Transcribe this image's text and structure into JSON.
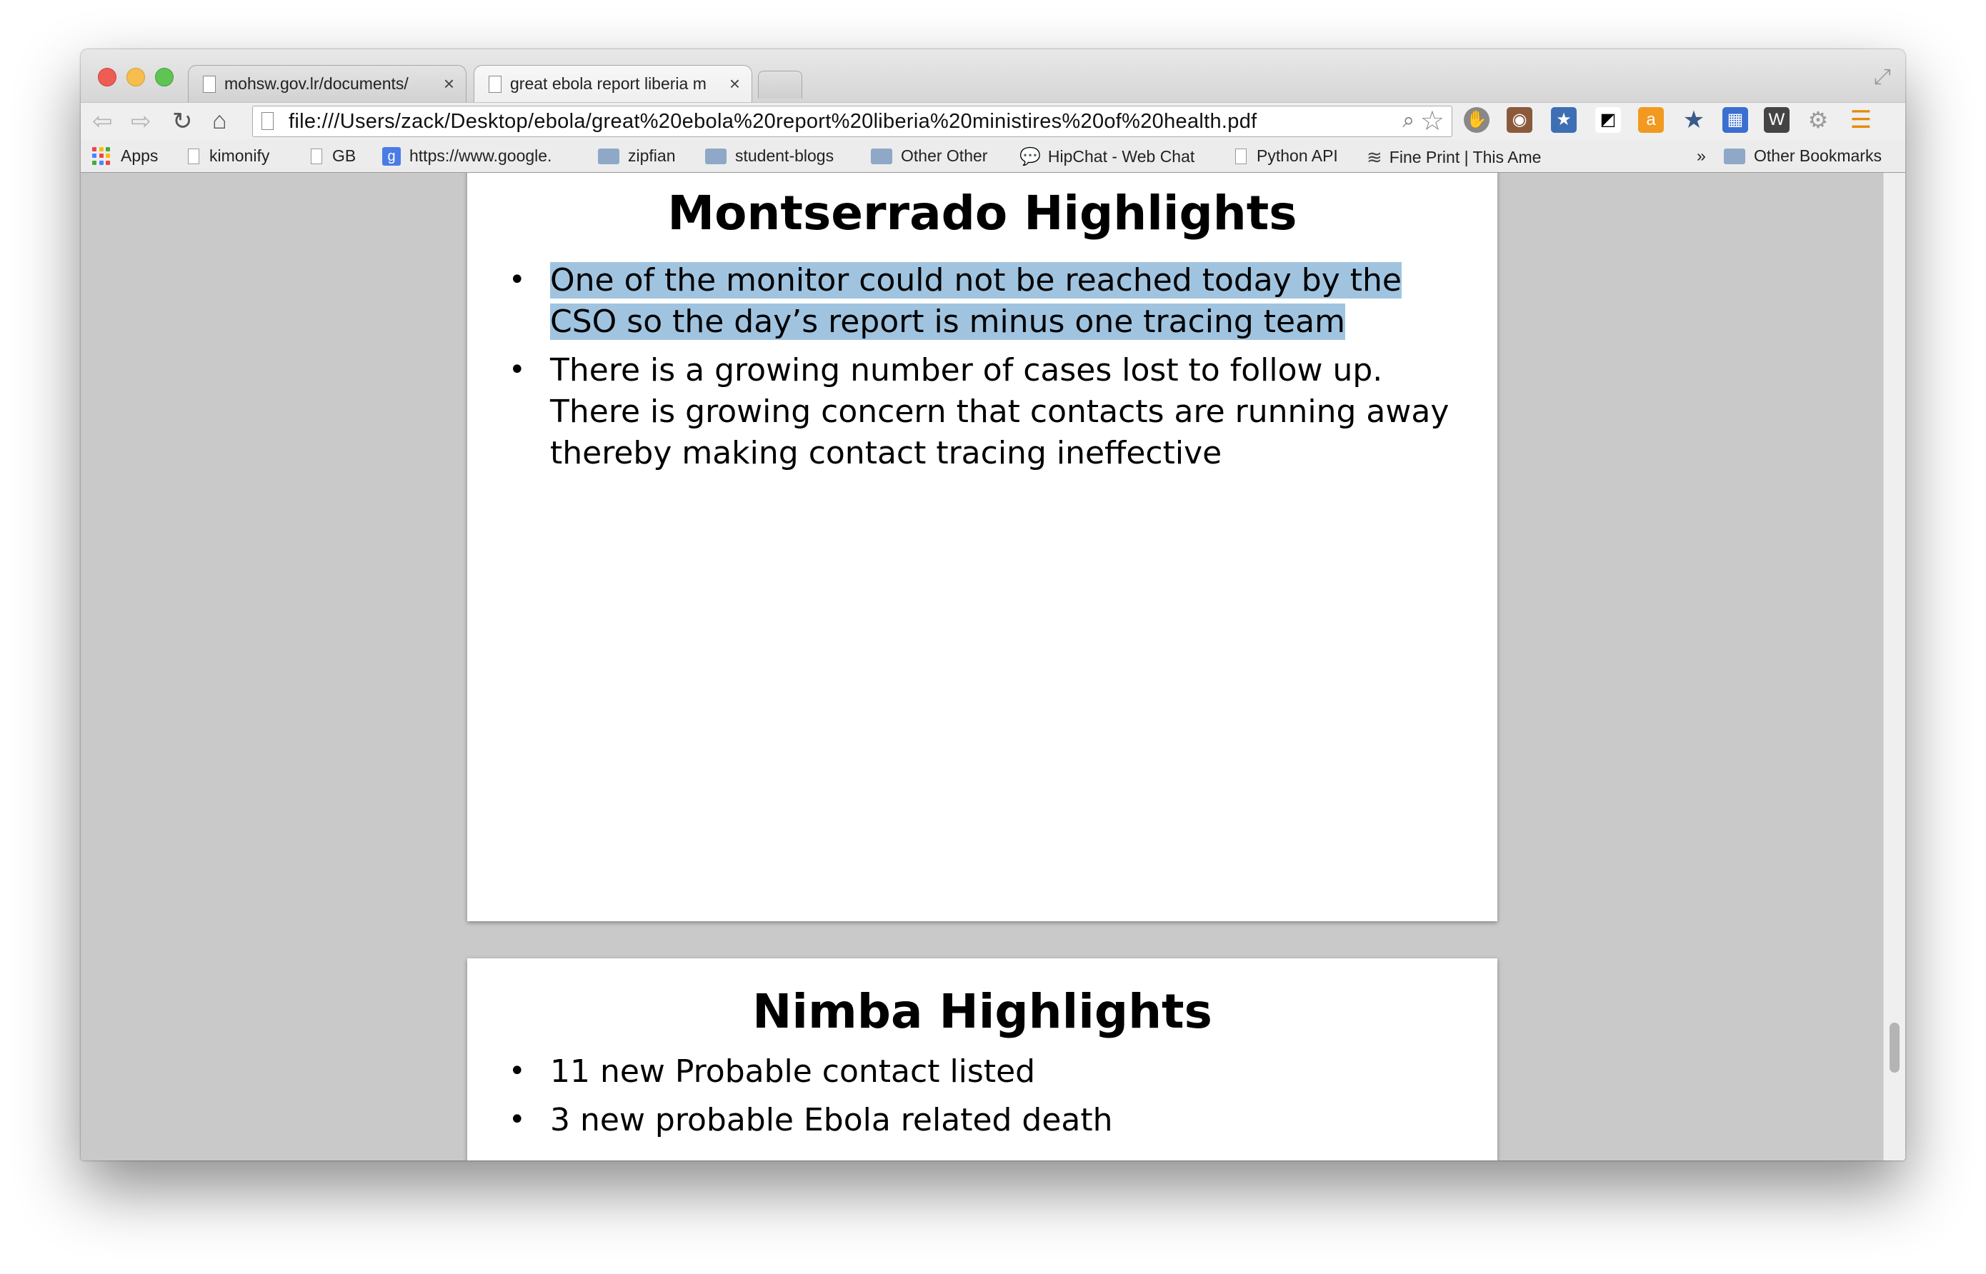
{
  "tabs": [
    {
      "label": "mohsw.gov.lr/documents/",
      "close": "×"
    },
    {
      "label": "great ebola report liberia m",
      "close": "×"
    }
  ],
  "toolbar": {
    "url": "file:///Users/zack/Desktop/ebola/great%20ebola%20report%20liberia%20ministires%20of%20health.pdf"
  },
  "bookmarks": {
    "items": [
      {
        "label": "Apps",
        "icon": "apps-grid-icon"
      },
      {
        "label": "kimonify",
        "icon": "page-icon"
      },
      {
        "label": "GB",
        "icon": "page-icon"
      },
      {
        "label": "https://www.google.",
        "icon": "google-icon"
      },
      {
        "label": "zipfian",
        "icon": "folder-icon"
      },
      {
        "label": "student-blogs",
        "icon": "folder-icon"
      },
      {
        "label": "Other Other",
        "icon": "folder-icon"
      },
      {
        "label": "HipChat - Web Chat",
        "icon": "chat-icon"
      },
      {
        "label": "Python API",
        "icon": "page-icon"
      },
      {
        "label": "Fine Print | This Ame",
        "icon": "rss-icon"
      }
    ],
    "overflow": "»",
    "other": "Other Bookmarks"
  },
  "slides": [
    {
      "title": "Montserrado Highlights",
      "bullets": [
        "One of the monitor could not be reached today by the CSO so the day’s report is minus one tracing team",
        "There is a growing number of cases lost to follow up. There is growing concern that contacts are running away thereby making contact tracing ineffective"
      ]
    },
    {
      "title": "Nimba Highlights",
      "bullets": [
        "11 new Probable contact listed",
        "3 new probable Ebola related death"
      ]
    }
  ],
  "colors": {
    "selection_highlight": "#a0c4e0",
    "viewer_background": "#c9c9c9"
  }
}
